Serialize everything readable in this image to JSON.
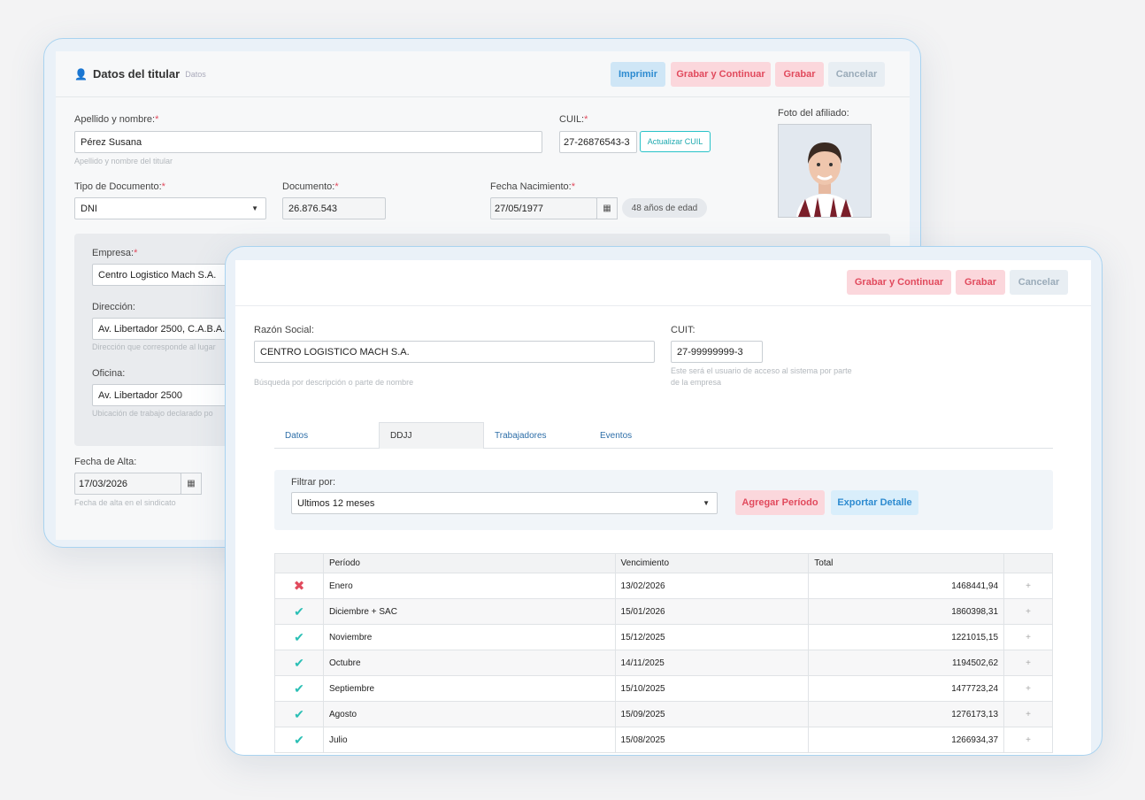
{
  "back": {
    "title": "Datos del titular",
    "subtitle": "Datos",
    "buttons": {
      "print": "Imprimir",
      "save_continue": "Grabar y Continuar",
      "save": "Grabar",
      "cancel": "Cancelar"
    },
    "name_label": "Apellido y nombre:",
    "name_value": "Pérez Susana",
    "name_hint": "Apellido y nombre del titular",
    "cuil_label": "CUIL:",
    "cuil_value": "27-26876543-3",
    "cuil_update": "Actualizar CUIL",
    "photo_label": "Foto del afiliado:",
    "doc_type_label": "Tipo de Documento:",
    "doc_type_value": "DNI",
    "doc_label": "Documento:",
    "doc_value": "26.876.543",
    "birth_label": "Fecha Nacimiento:",
    "birth_value": "27/05/1977",
    "age_badge": "48 años de edad",
    "company_label": "Empresa:",
    "company_value": "Centro Logistico Mach S.A.",
    "address_label": "Dirección:",
    "address_value": "Av. Libertador 2500, C.A.B.A.",
    "address_hint": "Dirección que corresponde al lugar",
    "office_label": "Oficina:",
    "office_value": "Av. Libertador 2500",
    "office_hint": "Ubicación de trabajo declarado po",
    "signup_label": "Fecha de Alta:",
    "signup_value": "17/03/2026",
    "signup_hint": "Fecha de alta en el sindicato"
  },
  "front": {
    "buttons": {
      "save_continue": "Grabar y Continuar",
      "save": "Grabar",
      "cancel": "Cancelar"
    },
    "razon_label": "Razón Social:",
    "razon_value": "CENTRO LOGISTICO MACH S.A.",
    "razon_hint": "Búsqueda por descripción o parte de nombre",
    "cuit_label": "CUIT:",
    "cuit_value": "27-99999999-3",
    "cuit_hint": "Este será el usuario de acceso al sistema por parte de la empresa",
    "tabs": [
      "Datos",
      "DDJJ",
      "Trabajadores",
      "Eventos"
    ],
    "filter_label": "Filtrar por:",
    "filter_value": "Ultimos 12 meses",
    "add_period": "Agregar Período",
    "export": "Exportar Detalle",
    "table": {
      "headers": [
        "",
        "Período",
        "Vencimiento",
        "Total",
        ""
      ],
      "rows": [
        {
          "status": "error",
          "period": "Enero",
          "due": "13/02/2026",
          "total": "1468441,94"
        },
        {
          "status": "ok",
          "period": "Diciembre + SAC",
          "due": "15/01/2026",
          "total": "1860398,31"
        },
        {
          "status": "ok",
          "period": "Noviembre",
          "due": "15/12/2025",
          "total": "1221015,15"
        },
        {
          "status": "ok",
          "period": "Octubre",
          "due": "14/11/2025",
          "total": "1194502,62"
        },
        {
          "status": "ok",
          "period": "Septiembre",
          "due": "15/10/2025",
          "total": "1477723,24"
        },
        {
          "status": "ok",
          "period": "Agosto",
          "due": "15/09/2025",
          "total": "1276173,13"
        },
        {
          "status": "ok",
          "period": "Julio",
          "due": "15/08/2025",
          "total": "1266934,37"
        }
      ]
    }
  },
  "icons": {
    "user": "user-check-icon",
    "calendar": "calendar-icon",
    "ok": "check-icon",
    "error": "cross-icon",
    "expand": "plus-icon"
  }
}
